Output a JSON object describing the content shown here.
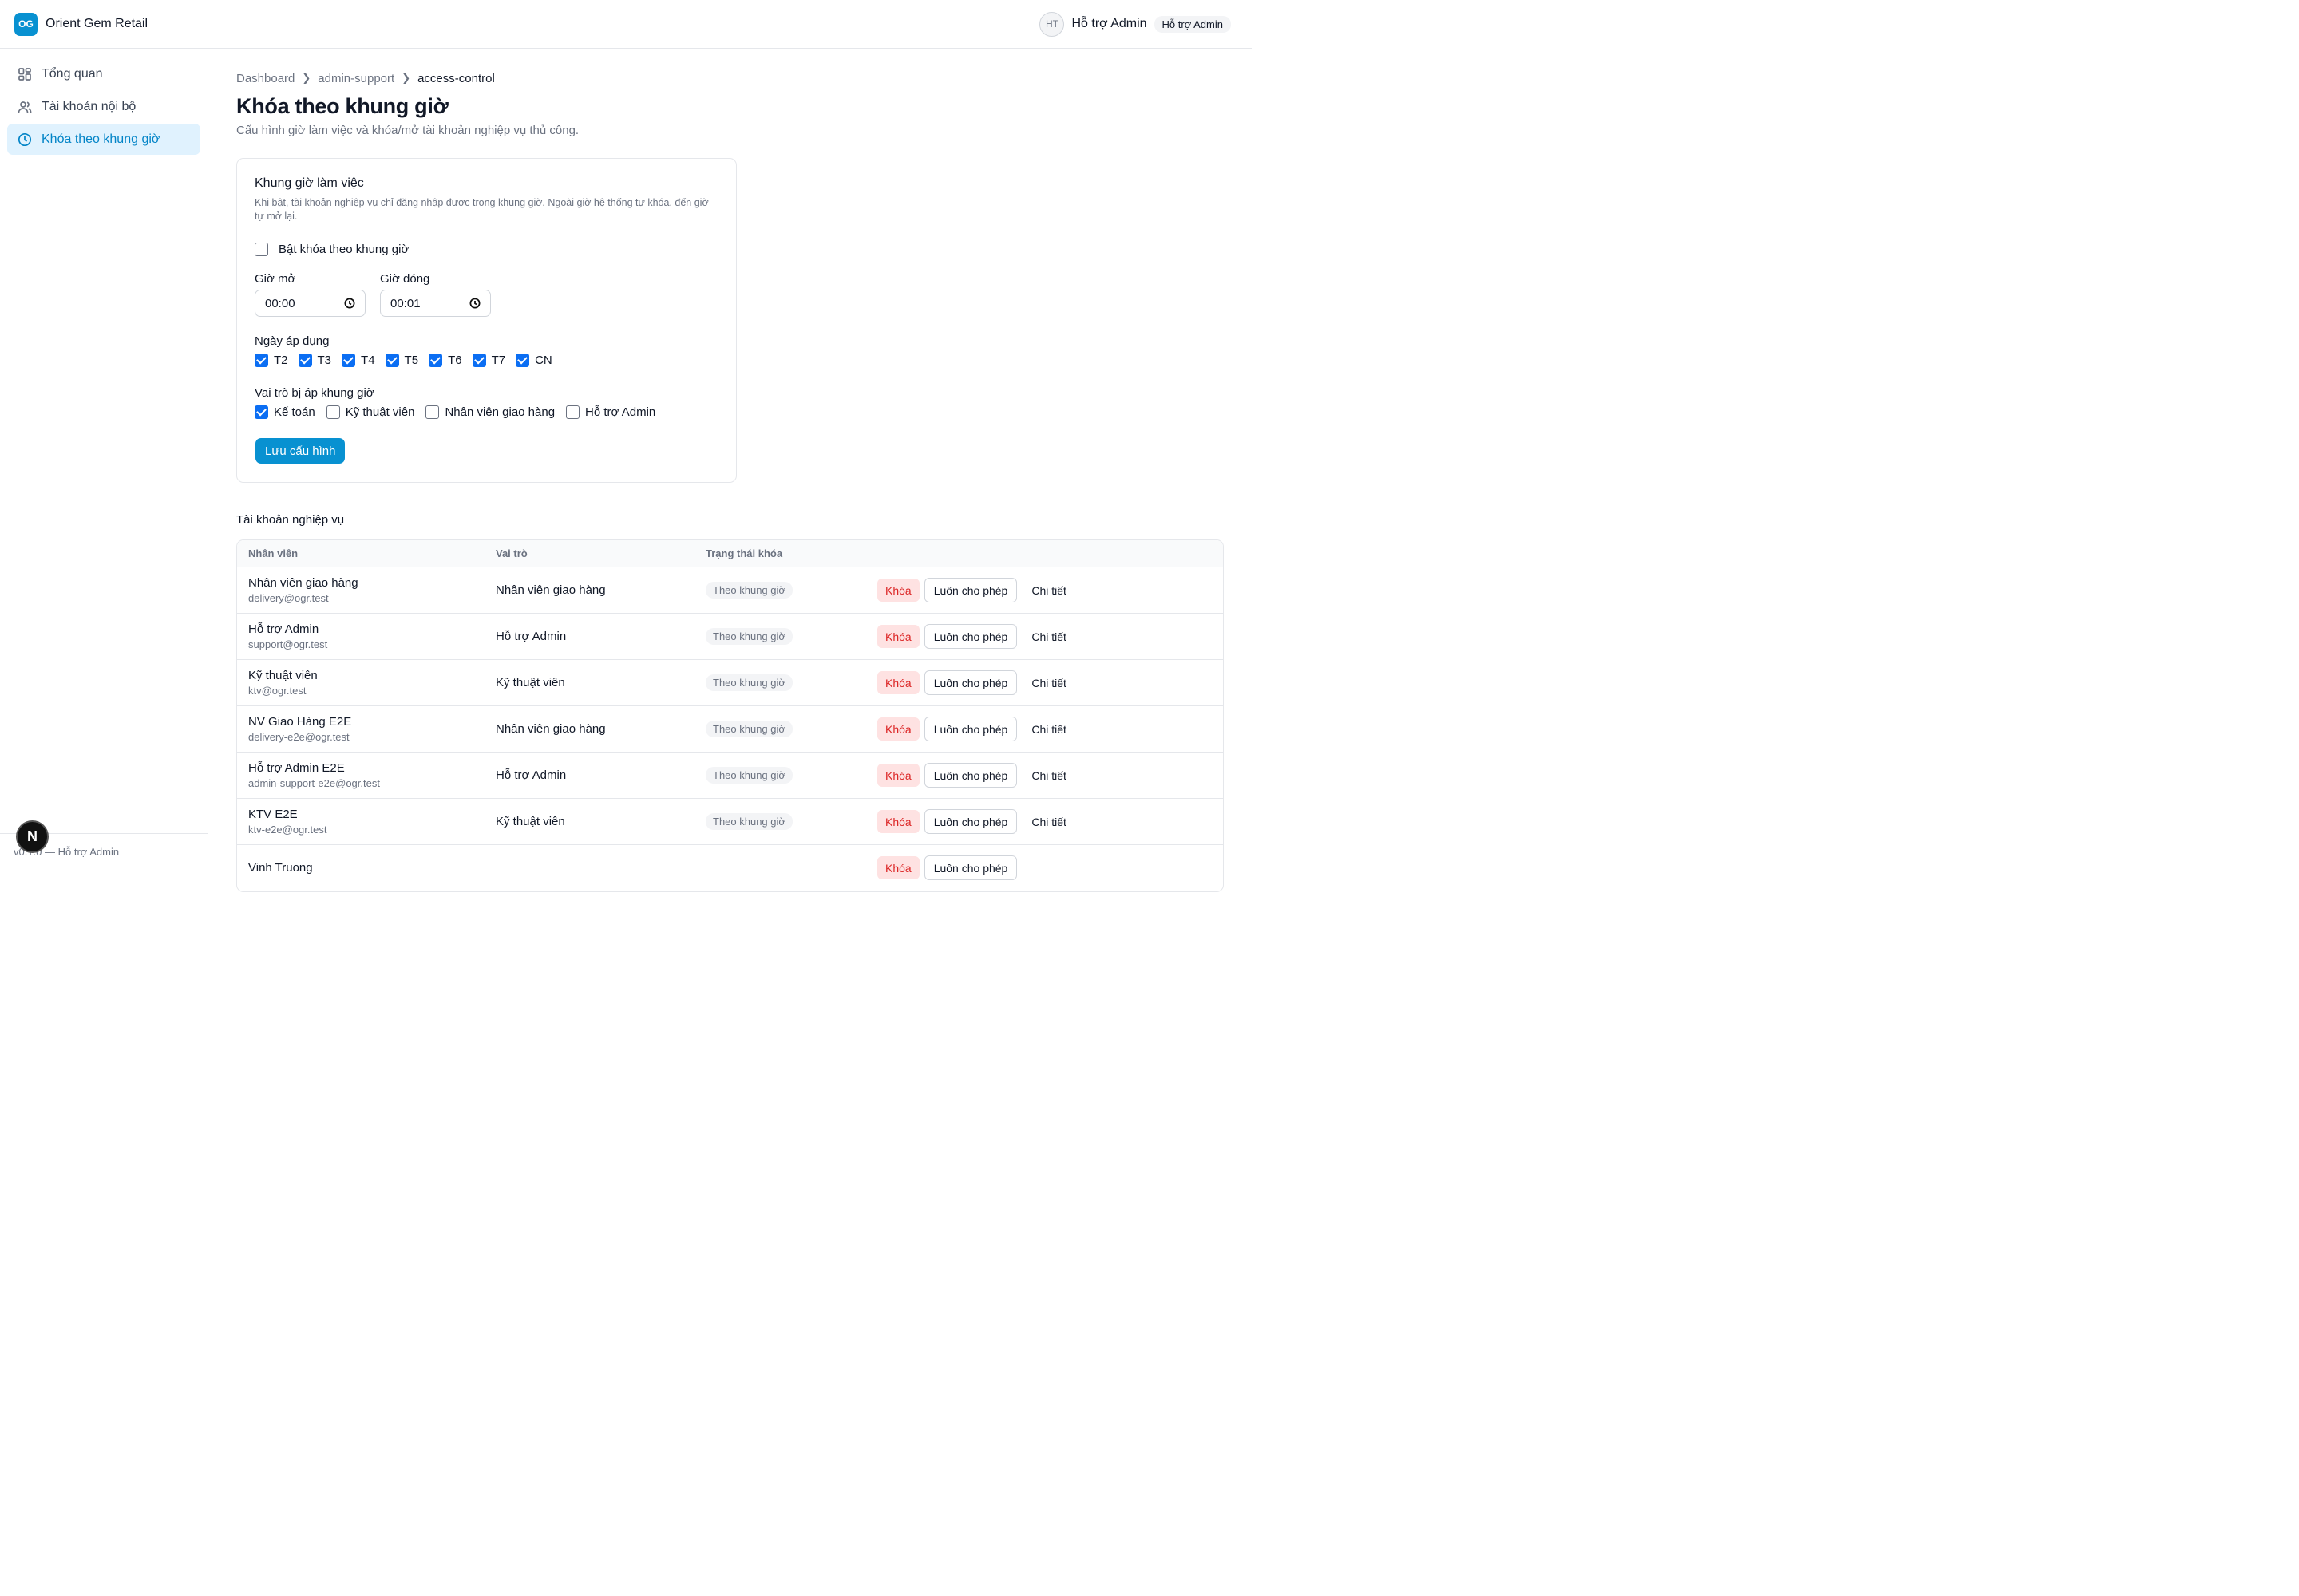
{
  "brand": {
    "logo": "OG",
    "name": "Orient Gem Retail"
  },
  "sidebar": {
    "items": [
      {
        "label": "Tổng quan",
        "icon": "dashboard-grid-icon"
      },
      {
        "label": "Tài khoản nội bộ",
        "icon": "users-icon"
      },
      {
        "label": "Khóa theo khung giờ",
        "icon": "clock-icon",
        "active": true
      }
    ],
    "footer": "v0.1.0 — Hỗ trợ Admin"
  },
  "header": {
    "avatar": "HT",
    "user_name": "Hỗ trợ Admin",
    "role_badge": "Hỗ trợ Admin"
  },
  "breadcrumb": [
    "Dashboard",
    "admin-support",
    "access-control"
  ],
  "page": {
    "title": "Khóa theo khung giờ",
    "subtitle": "Cấu hình giờ làm việc và khóa/mở tài khoản nghiệp vụ thủ công."
  },
  "schedule": {
    "title": "Khung giờ làm việc",
    "description": "Khi bật, tài khoản nghiệp vụ chỉ đăng nhập được trong khung giờ. Ngoài giờ hệ thống tự khóa, đến giờ tự mở lại.",
    "enable_label": "Bật khóa theo khung giờ",
    "enabled": false,
    "open_label": "Giờ mở",
    "open_value": "00:00",
    "close_label": "Giờ đóng",
    "close_value": "00:01",
    "days_label": "Ngày áp dụng",
    "days": [
      {
        "label": "T2",
        "checked": true
      },
      {
        "label": "T3",
        "checked": true
      },
      {
        "label": "T4",
        "checked": true
      },
      {
        "label": "T5",
        "checked": true
      },
      {
        "label": "T6",
        "checked": true
      },
      {
        "label": "T7",
        "checked": true
      },
      {
        "label": "CN",
        "checked": true
      }
    ],
    "roles_label": "Vai trò bị áp khung giờ",
    "roles": [
      {
        "label": "Kế toán",
        "checked": true
      },
      {
        "label": "Kỹ thuật viên",
        "checked": false
      },
      {
        "label": "Nhân viên giao hàng",
        "checked": false
      },
      {
        "label": "Hỗ trợ Admin",
        "checked": false
      }
    ],
    "save_label": "Lưu cấu hình"
  },
  "accounts": {
    "title": "Tài khoản nghiệp vụ",
    "columns": [
      "Nhân viên",
      "Vai trò",
      "Trạng thái khóa"
    ],
    "lock_label": "Khóa",
    "allow_label": "Luôn cho phép",
    "detail_label": "Chi tiết",
    "rows": [
      {
        "name": "Nhân viên giao hàng",
        "email": "delivery@ogr.test",
        "role": "Nhân viên giao hàng",
        "status": "Theo khung giờ"
      },
      {
        "name": "Hỗ trợ Admin",
        "email": "support@ogr.test",
        "role": "Hỗ trợ Admin",
        "status": "Theo khung giờ"
      },
      {
        "name": "Kỹ thuật viên",
        "email": "ktv@ogr.test",
        "role": "Kỹ thuật viên",
        "status": "Theo khung giờ"
      },
      {
        "name": "NV Giao Hàng E2E",
        "email": "delivery-e2e@ogr.test",
        "role": "Nhân viên giao hàng",
        "status": "Theo khung giờ"
      },
      {
        "name": "Hỗ trợ Admin E2E",
        "email": "admin-support-e2e@ogr.test",
        "role": "Hỗ trợ Admin",
        "status": "Theo khung giờ"
      },
      {
        "name": "KTV E2E",
        "email": "ktv-e2e@ogr.test",
        "role": "Kỹ thuật viên",
        "status": "Theo khung giờ"
      },
      {
        "name": "Vinh Truong",
        "email": "",
        "role": "",
        "status": ""
      }
    ]
  },
  "dev_badge": "N",
  "colors": {
    "accent": "#0891d1",
    "checkbox": "#0b6ef3",
    "danger": "#dc2626",
    "danger_bg": "#fee2e2"
  }
}
